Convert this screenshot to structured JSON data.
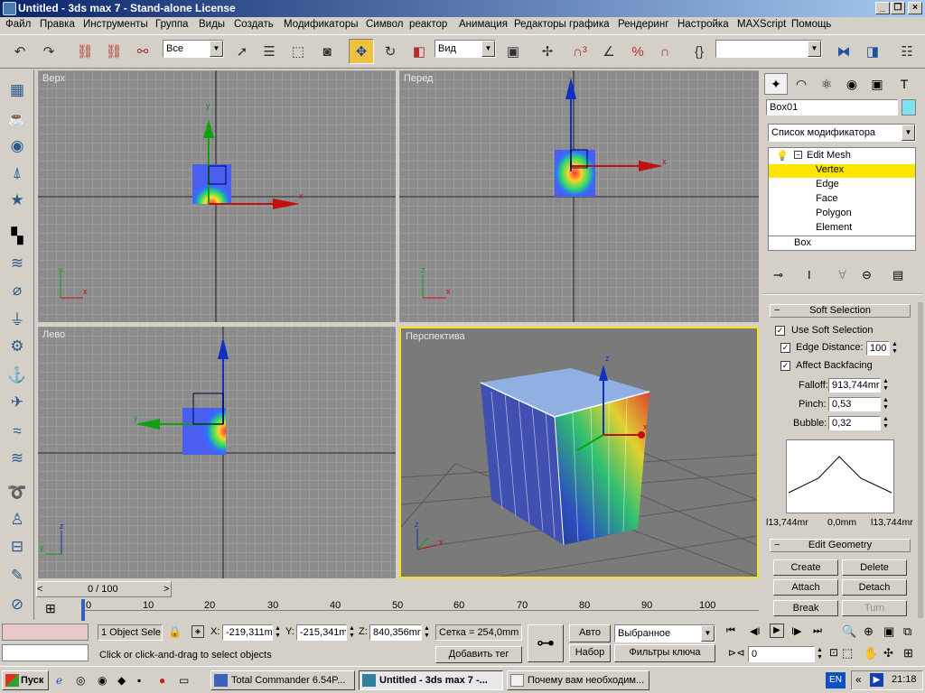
{
  "window": {
    "title": "Untitled - 3ds max 7 - Stand-alone License"
  },
  "menu": [
    "Файл",
    "Правка",
    "Инструменты",
    "Группа",
    "Виды",
    "Создать",
    "Модификаторы",
    "Символ",
    "реактор",
    "Анимация",
    "Редакторы графика",
    "Рендеринг",
    "Настройка",
    "MAXScript",
    "Помощь"
  ],
  "toolbar": {
    "selection_filter": "Все",
    "ref_coord": "Вид",
    "named_selection": ""
  },
  "viewports": {
    "top": "Верх",
    "front": "Перед",
    "left": "Лево",
    "perspective": "Перспектива"
  },
  "axes": {
    "x": "x",
    "y": "y",
    "z": "z"
  },
  "command_panel": {
    "object_name": "Box01",
    "object_color": "#7fe0ee",
    "modifier_list": "Список модификатора",
    "stack": [
      {
        "label": "Edit Mesh"
      },
      {
        "label": "Vertex"
      },
      {
        "label": "Edge"
      },
      {
        "label": "Face"
      },
      {
        "label": "Polygon"
      },
      {
        "label": "Element"
      },
      {
        "label": "Box"
      }
    ],
    "soft_selection": {
      "header": "Soft Selection",
      "use_soft": "Use Soft Selection",
      "edge_distance": "Edge Distance:",
      "edge_distance_value": "100",
      "affect_backfacing": "Affect Backfacing",
      "falloff_label": "Falloff:",
      "falloff_value": "913,744mr",
      "pinch_label": "Pinch:",
      "pinch_value": "0,53",
      "bubble_label": "Bubble:",
      "bubble_value": "0,32",
      "curve_left": "l13,744mr",
      "curve_mid": "0,0mm",
      "curve_right": "l13,744mr"
    },
    "edit_geometry": {
      "header": "Edit Geometry",
      "create": "Create",
      "delete": "Delete",
      "attach": "Attach",
      "detach": "Detach",
      "break": "Break",
      "turn": "Turn"
    }
  },
  "timeline": {
    "frame": "0 / 100",
    "ticks": [
      "0",
      "10",
      "20",
      "30",
      "40",
      "50",
      "60",
      "70",
      "80",
      "90",
      "100"
    ]
  },
  "status": {
    "selection": "1 Object Sele",
    "x_label": "X:",
    "x_value": "-219,311mi",
    "y_label": "Y:",
    "y_value": "-215,341mi",
    "z_label": "Z:",
    "z_value": "840,356mn",
    "grid": "Сетка = 254,0mm",
    "prompt": "Click or click-and-drag to select objects",
    "add_tag": "Добавить тег",
    "auto": "Авто",
    "set": "Набор",
    "selected": "Выбранное",
    "key_filters": "Фильтры ключа",
    "current_frame": "0"
  },
  "taskbar": {
    "start": "Пуск",
    "tasks": [
      "Total Commander 6.54P...",
      "Untitled - 3ds max 7 -...",
      "Почему вам необходим..."
    ],
    "lang": "EN",
    "time": "21:18"
  }
}
